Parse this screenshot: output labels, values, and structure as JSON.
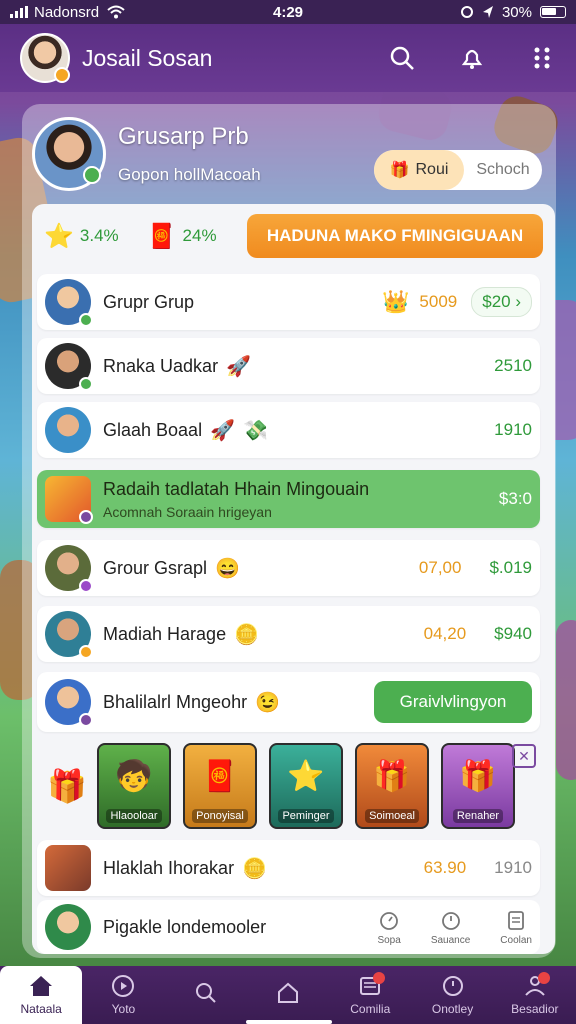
{
  "status": {
    "carrier": "Nadonsrd",
    "time": "4:29",
    "battery": "30%"
  },
  "header": {
    "user_name": "Josail Sosan"
  },
  "profile": {
    "name": "Grusarp Prb",
    "subtitle": "Gopon hollMacoah",
    "seg_active": "Roui",
    "seg_other": "Schoch"
  },
  "summary": {
    "stat1": "3.4%",
    "stat2": "24%",
    "cta": "HADUNA MAKO FMINGIGUAAN"
  },
  "rows": [
    {
      "name": "Grupr Grup",
      "value": "5009",
      "pill": "$20 ›"
    },
    {
      "name": "Rnaka Uadkar",
      "value": "2510"
    },
    {
      "name": "Glaah Boaal",
      "value": "1910"
    },
    {
      "name": "Radaih tadlatah Hhain Mingouain",
      "sub": "Acomnah Soraain hrigeyan",
      "value": "$3:0"
    },
    {
      "name": "Grour Gsrapl",
      "value1": "07,00",
      "value2": "$.019"
    },
    {
      "name": "Madiah Harage",
      "value1": "04,20",
      "value2": "$940"
    },
    {
      "name": "Bhalilalrl Mngeohr",
      "button": "Graivlvlingyon"
    },
    {
      "name": "Hlaklah Ihorakar",
      "value1": "63.90",
      "value2": "1910"
    },
    {
      "name": "Pigakle londemooler"
    }
  ],
  "tiles": [
    {
      "label": "Hlaooloar"
    },
    {
      "label": "Ponoyisal"
    },
    {
      "label": "Peminger"
    },
    {
      "label": "Soimoeal"
    },
    {
      "label": "Renaher"
    }
  ],
  "mini_nav": [
    "Sopa",
    "Sauance",
    "Coolan"
  ],
  "bottom_nav": [
    "Nataala",
    "Yoto",
    "",
    "",
    "Comilia",
    "Onotley",
    "Besadior"
  ],
  "colors": {
    "accent_purple": "#5b2f84",
    "orange": "#f08b1f",
    "green": "#4caf50"
  }
}
